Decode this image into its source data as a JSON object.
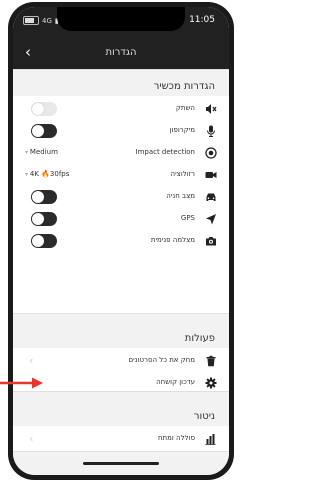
{
  "status": {
    "network": "4G",
    "time": "11:05"
  },
  "nav": {
    "title": "הגדרות",
    "back_icon": "chevron-left-icon"
  },
  "sections": {
    "device": {
      "title": "הגדרות מכשיר",
      "rows": [
        {
          "label": "השתק",
          "icon": "mute-icon",
          "control": "toggle",
          "state": false
        },
        {
          "label": "מיקרופון",
          "icon": "microphone-icon",
          "control": "toggle",
          "state": true
        },
        {
          "label": "Impact detection",
          "icon": "target-icon",
          "control": "select",
          "value": "Medium"
        },
        {
          "label": "רזולוציה",
          "icon": "video-camera-icon",
          "control": "select",
          "value": "4K",
          "value_suffix": "30fps"
        },
        {
          "label": "מצב חניה",
          "icon": "car-icon",
          "control": "toggle",
          "state": true
        },
        {
          "label": "GPS",
          "icon": "location-arrow-icon",
          "control": "toggle",
          "state": true
        },
        {
          "label": "מצלמה פנימית",
          "icon": "camera-icon",
          "control": "toggle",
          "state": true
        }
      ]
    },
    "actions": {
      "title": "פעולות",
      "rows": [
        {
          "label": "מחק את כל הסרטונים",
          "icon": "trash-icon"
        },
        {
          "label": "עדכון קושחה",
          "icon": "gear-icon"
        }
      ]
    },
    "monitoring": {
      "title": "ניטור",
      "rows": [
        {
          "label": "סוללה ומתח",
          "icon": "bar-chart-icon"
        }
      ]
    }
  },
  "colors": {
    "accent_arrow": "#e8362c",
    "fire": "#ff6a00",
    "toggle_on": "#2b2b2b"
  }
}
